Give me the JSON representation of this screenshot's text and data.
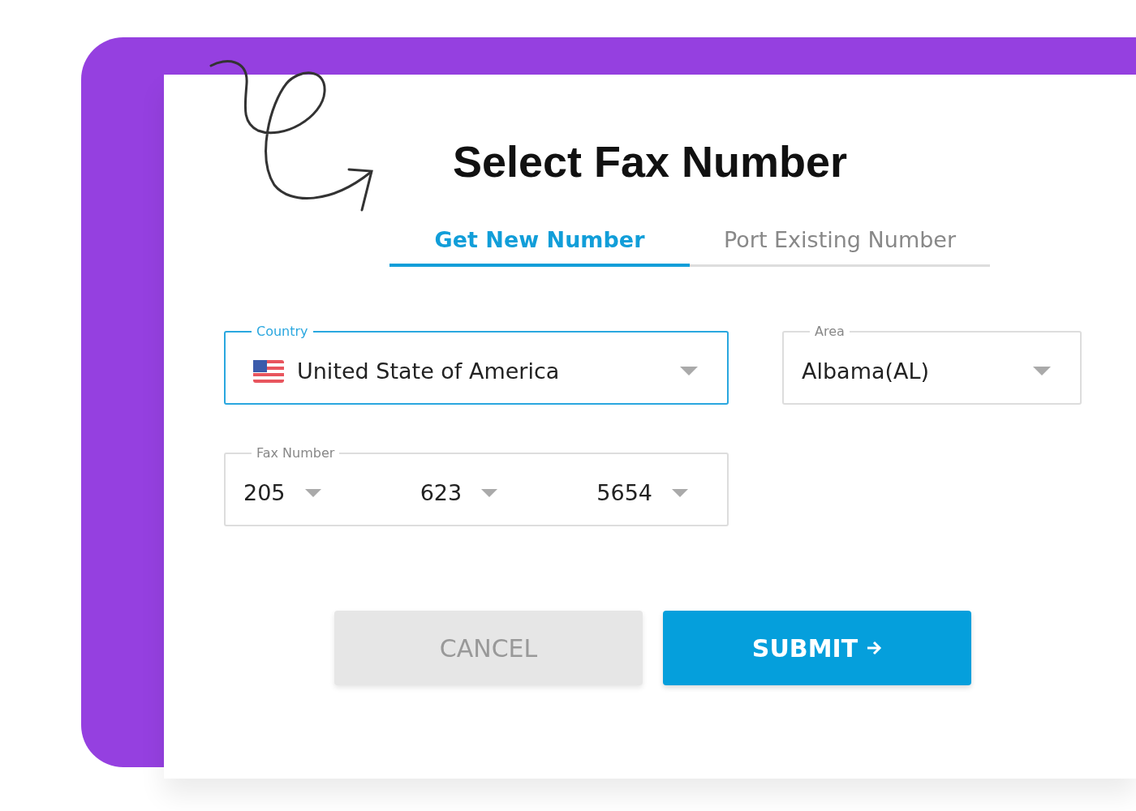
{
  "title": "Select Fax Number",
  "tabs": [
    {
      "label": "Get New Number",
      "selected": true
    },
    {
      "label": "Port Existing Number",
      "selected": false
    }
  ],
  "fields": [
    {
      "kind": "country",
      "label": "Country",
      "value": "United State of America",
      "focused": true
    },
    {
      "kind": "area",
      "label": "Area",
      "value": "Albama(AL)",
      "focused": false
    }
  ],
  "fax_number": {
    "label": "Fax Number",
    "parts": [
      "205",
      "623",
      "5654"
    ]
  },
  "buttons": [
    {
      "label": "CANCEL",
      "kind": "secondary"
    },
    {
      "label": "SUBMIT",
      "kind": "primary"
    }
  ]
}
